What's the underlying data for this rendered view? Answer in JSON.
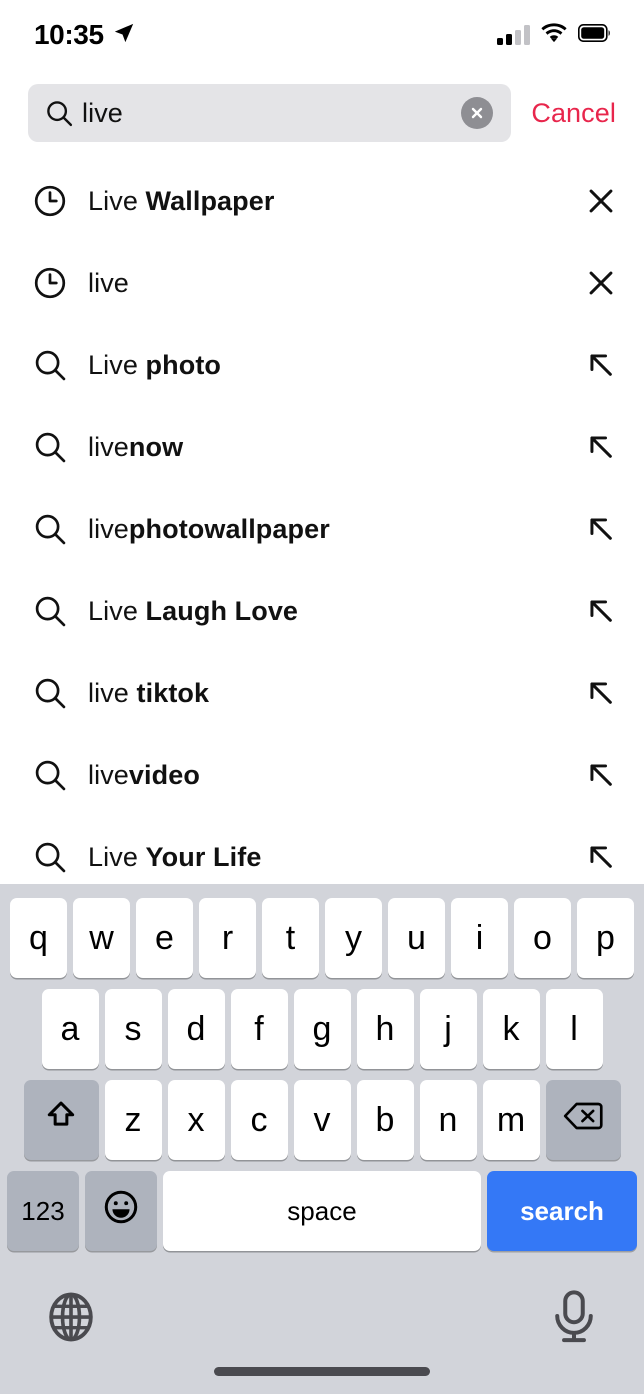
{
  "status_bar": {
    "time": "10:35",
    "location_icon": "location-arrow-icon",
    "cellular_icon": "cellular-bars-icon",
    "cellular_bars_filled": 2,
    "cellular_bars_total": 4,
    "wifi_icon": "wifi-icon",
    "battery_icon": "battery-icon"
  },
  "search": {
    "icon": "search-icon",
    "value": "live",
    "placeholder": "Search",
    "clear_icon": "clear-circle-icon",
    "cancel_label": "Cancel",
    "cancel_color": "#e8264c",
    "field_bg": "#e4e4e7"
  },
  "suggestions": [
    {
      "lead_icon": "clock-icon",
      "prefix": "Live ",
      "bold": "Wallpaper",
      "full_text": "Live Wallpaper",
      "trail_icon": "close-x-icon",
      "type": "history"
    },
    {
      "lead_icon": "clock-icon",
      "prefix": "live",
      "bold": "",
      "full_text": "live",
      "trail_icon": "close-x-icon",
      "type": "history"
    },
    {
      "lead_icon": "search-icon",
      "prefix": "Live ",
      "bold": "photo",
      "full_text": "Live photo",
      "trail_icon": "arrow-up-left-icon",
      "type": "suggestion"
    },
    {
      "lead_icon": "search-icon",
      "prefix": "live",
      "bold": "now",
      "full_text": "livenow",
      "trail_icon": "arrow-up-left-icon",
      "type": "suggestion"
    },
    {
      "lead_icon": "search-icon",
      "prefix": "live",
      "bold": "photowallpaper",
      "full_text": "livephotowallpaper",
      "trail_icon": "arrow-up-left-icon",
      "type": "suggestion"
    },
    {
      "lead_icon": "search-icon",
      "prefix": "Live ",
      "bold": "Laugh Love",
      "full_text": "Live Laugh Love",
      "trail_icon": "arrow-up-left-icon",
      "type": "suggestion"
    },
    {
      "lead_icon": "search-icon",
      "prefix": "live ",
      "bold": "tiktok",
      "full_text": "live tiktok",
      "trail_icon": "arrow-up-left-icon",
      "type": "suggestion"
    },
    {
      "lead_icon": "search-icon",
      "prefix": "live",
      "bold": "video",
      "full_text": "livevideo",
      "trail_icon": "arrow-up-left-icon",
      "type": "suggestion"
    },
    {
      "lead_icon": "search-icon",
      "prefix": "Live ",
      "bold": "Your Life",
      "full_text": "Live Your Life",
      "trail_icon": "arrow-up-left-icon",
      "type": "suggestion"
    }
  ],
  "keyboard": {
    "background": "#d2d4da",
    "key_bg": "#ffffff",
    "modifier_key_bg": "#aeb3bd",
    "row1": [
      "q",
      "w",
      "e",
      "r",
      "t",
      "y",
      "u",
      "i",
      "o",
      "p"
    ],
    "row2": [
      "a",
      "s",
      "d",
      "f",
      "g",
      "h",
      "j",
      "k",
      "l"
    ],
    "row3": [
      "z",
      "x",
      "c",
      "v",
      "b",
      "n",
      "m"
    ],
    "shift_icon": "shift-arrow-icon",
    "backspace_icon": "backspace-delete-icon",
    "numbers_label": "123",
    "emoji_icon": "emoji-smiley-icon",
    "space_label": "space",
    "search_label": "search",
    "search_key_color": "#3478f6",
    "globe_icon": "globe-icon",
    "mic_icon": "microphone-icon"
  }
}
